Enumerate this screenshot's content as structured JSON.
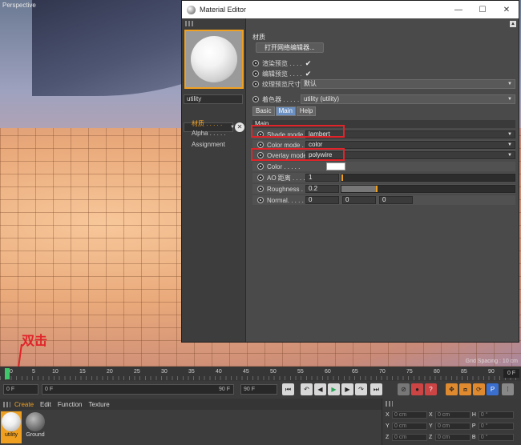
{
  "viewport": {
    "label": "Perspective",
    "grid_spacing": "Grid Spacing : 10 cm"
  },
  "editor": {
    "title": "Material Editor",
    "window_buttons": {
      "minimize": "—",
      "maximize": "☐",
      "close": "✕"
    },
    "material_name": "utility",
    "channels": [
      {
        "label": "材质 . . . . .",
        "active": true
      },
      {
        "label": "Alpha . . . . .",
        "active": false
      },
      {
        "label": "Assignment",
        "active": false
      }
    ],
    "section_label": "材质",
    "open_node_editor": "打开网络编辑器...",
    "render_preview": {
      "label": "渲染预览 . . . ."
    },
    "editor_preview": {
      "label": "编辑预览 . . . ."
    },
    "texture_preview_size": {
      "label": "纹理预览尺寸",
      "value": "默认"
    },
    "shader": {
      "label": "着色器 . . . . .",
      "value": "utility (utility)"
    },
    "tabs": [
      "Basic",
      "Main",
      "Help"
    ],
    "main_header": "Main",
    "shade_mode": {
      "label": "Shade mode",
      "value": "lambert"
    },
    "color_mode": {
      "label": "Color mode . .",
      "value": "color"
    },
    "overlay_mode": {
      "label": "Overlay mode",
      "value": "polywire"
    },
    "color": {
      "label": "Color . . . . ."
    },
    "ao_distance": {
      "label": "AO 距离 . . . .",
      "value": "1"
    },
    "roughness": {
      "label": "Roughness . .",
      "value": "0.2"
    },
    "normal": {
      "label": "Normal. . . . .",
      "values": [
        "0",
        "0",
        "0"
      ]
    }
  },
  "annotation": "双击",
  "timeline": {
    "ticks": [
      "0",
      "5",
      "10",
      "15",
      "20",
      "25",
      "30",
      "35",
      "40",
      "45",
      "50",
      "55",
      "60",
      "65",
      "70",
      "75",
      "80",
      "85",
      "90"
    ],
    "current_frame": "0 F"
  },
  "transport": {
    "start": "0 F",
    "preview_start": "0 F",
    "preview_end": "90 F",
    "end": "90 F"
  },
  "material_manager": {
    "menu": [
      "Create",
      "Edit",
      "Function",
      "Texture"
    ],
    "materials": [
      {
        "name": "utility",
        "selected": true
      },
      {
        "name": "Ground",
        "selected": false
      }
    ]
  },
  "coordinates": {
    "rows": [
      {
        "axis": "X",
        "value": "0 cm",
        "axis2": "X",
        "value2": "0 cm",
        "axis3": "H",
        "value3": "0 °"
      },
      {
        "axis": "Y",
        "value": "0 cm",
        "axis2": "Y",
        "value2": "0 cm",
        "axis3": "P",
        "value3": "0 °"
      },
      {
        "axis": "Z",
        "value": "0 cm",
        "axis2": "Z",
        "value2": "0 cm",
        "axis3": "B",
        "value3": "0 °"
      }
    ]
  },
  "colors": {
    "accent": "#f0a020",
    "highlight": "#e0242a",
    "tab_selected": "#6a8fc0",
    "play": "#3ec76a"
  }
}
